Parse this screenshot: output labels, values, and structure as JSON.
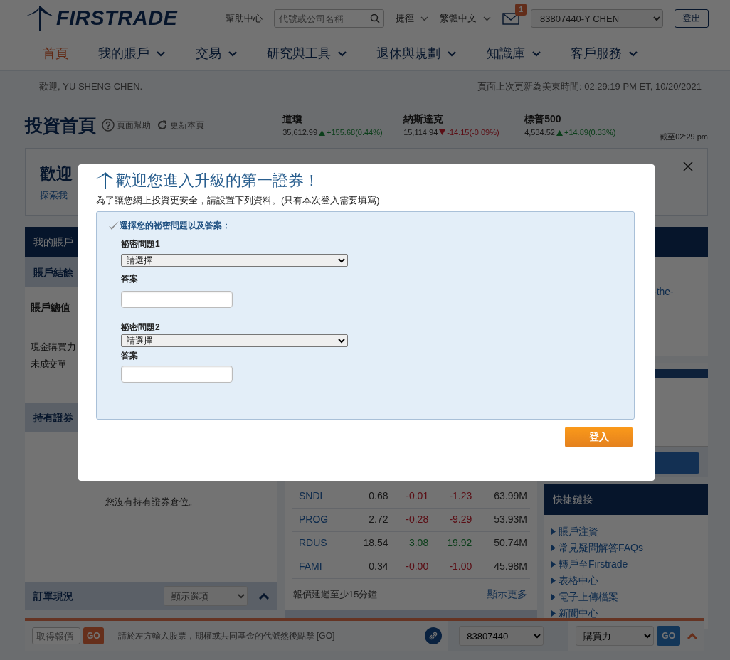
{
  "header": {
    "logo_text": "FIRSTRADE",
    "help": "幫助中心",
    "search": {
      "placeholder": "代號或公司名稱"
    },
    "shortcuts": "捷徑",
    "language": "繁體中文",
    "messages_badge": "1",
    "account": "83807440-Y CHEN",
    "logout": "登出"
  },
  "nav": [
    {
      "label": "首頁",
      "selected": true,
      "has_menu": false
    },
    {
      "label": "我的賬戶",
      "selected": false,
      "has_menu": true
    },
    {
      "label": "交易",
      "selected": false,
      "has_menu": true
    },
    {
      "label": "研究與工具",
      "selected": false,
      "has_menu": true
    },
    {
      "label": "退休與規劃",
      "selected": false,
      "has_menu": true
    },
    {
      "label": "知識庫",
      "selected": false,
      "has_menu": true
    },
    {
      "label": "客戶服務",
      "selected": false,
      "has_menu": true
    }
  ],
  "welcome": "歡迎, YU SHENG CHEN.",
  "last_updated": "頁面上次更新為美東時間: 02:29:19 PM ET, 10/20/2021",
  "page_title": "投資首頁",
  "page_help": "頁面幫助",
  "refresh": "更新本頁",
  "indices": [
    {
      "name": "道瓊",
      "value": "35,612.99",
      "change": "+155.68(0.44%)",
      "rising": true
    },
    {
      "name": "納斯達克",
      "value": "15,114.94",
      "change": "-14.15(-0.09%)",
      "rising": false
    },
    {
      "name": "標普500",
      "value": "4,534.52",
      "change": "+14.89(0.33%)",
      "rising": true
    }
  ],
  "as_of": "截至02:29 pm",
  "banner": {
    "title": "歡迎",
    "text": "探索我"
  },
  "account_panel": {
    "title": "我的賬戶",
    "balance_header": "賬戶結餘",
    "total_label": "賬戶總值",
    "rows": [
      "現金購買力",
      "未成交單"
    ],
    "holdings_header": "持有證券",
    "holdings_empty": "您沒有持有證券倉位。",
    "orders_title": "訂單現況",
    "orders_select": "顯示選項"
  },
  "movers": {
    "rows": [
      {
        "symbol": "SNDL",
        "price": "0.68",
        "change": "-0.01",
        "percent": "-1.23",
        "volume": "63.99M",
        "rising": false
      },
      {
        "symbol": "PROG",
        "price": "2.72",
        "change": "-0.28",
        "percent": "-9.29",
        "volume": "53.93M",
        "rising": false
      },
      {
        "symbol": "RDUS",
        "price": "18.54",
        "change": "3.08",
        "percent": "19.92",
        "volume": "50.74M",
        "rising": true
      },
      {
        "symbol": "FAMI",
        "price": "0.34",
        "change": "-0.00",
        "percent": "-1.00",
        "volume": "45.98M",
        "rising": false
      }
    ],
    "note": "報價延遲至少15分鐘",
    "more": "顯示更多"
  },
  "right_panel": {
    "link_fragment": "-the-"
  },
  "quick_links": {
    "title": "快捷鏈接",
    "items": [
      "賬戶注資",
      "常見疑問解答FAQs",
      "轉戶至Firstrade",
      "表格中心",
      "電子上傳檔案",
      "新聞中心"
    ]
  },
  "footer": {
    "quote": {
      "placeholder": "取得報價"
    },
    "go": "GO",
    "hint": "請於左方輸入股票，期權或共同基金的代號然後點擊 [GO]",
    "account": "83807440",
    "view": "購買力",
    "go2": "GO"
  },
  "modal": {
    "title": "歡迎您進入升級的第一證券！",
    "intro": "為了讓您網上投資更安全，請設置下列資料。(只有本次登入需要填寫)",
    "section_label": "選擇您的祕密問題以及答案：",
    "questions": [
      {
        "label": "祕密問題1",
        "select_value": "請選擇",
        "answer_label": "答案"
      },
      {
        "label": "祕密問題2",
        "select_value": "請選擇",
        "answer_label": "答案"
      }
    ],
    "submit": "登入"
  }
}
